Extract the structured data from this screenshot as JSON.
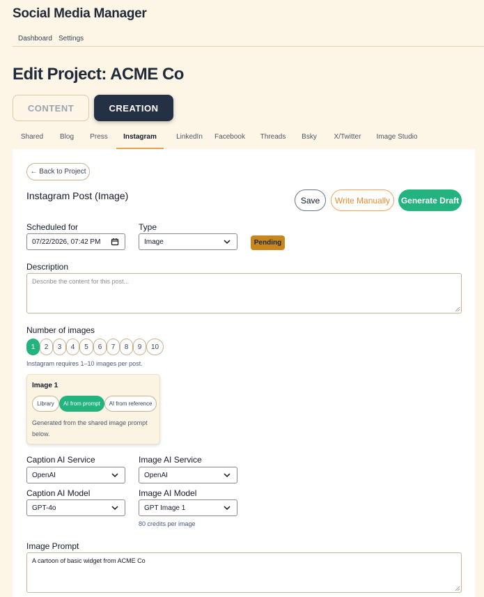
{
  "app": {
    "title": "Social Media Manager"
  },
  "topnav": {
    "items": [
      "Dashboard",
      "Settings"
    ]
  },
  "page": {
    "title": "Edit Project: ACME Co"
  },
  "modes": {
    "content": "CONTENT",
    "creation": "CREATION",
    "active": "CREATION"
  },
  "tabs": {
    "items": [
      "Shared",
      "Blog",
      "Press",
      "Instagram",
      "LinkedIn",
      "Facebook",
      "Threads",
      "Bsky",
      "X/Twitter",
      "Image Studio"
    ],
    "active": "Instagram"
  },
  "back_button": "← Back to Project",
  "post": {
    "title": "Instagram Post (Image)",
    "save_label": "Save",
    "write_manually_label": "Write Manually",
    "generate_label": "Generate Draft"
  },
  "schedule": {
    "label": "Scheduled for",
    "value": "07/22/2026, 07:42 PM"
  },
  "type": {
    "label": "Type",
    "value": "Image"
  },
  "status_badge": "Pending",
  "description": {
    "label": "Description",
    "placeholder": "Describe the content for this post..."
  },
  "images": {
    "label": "Number of images",
    "options": [
      "1",
      "2",
      "3",
      "4",
      "5",
      "6",
      "7",
      "8",
      "9",
      "10"
    ],
    "selected": "1",
    "hint": "Instagram requires 1–10 images per post."
  },
  "image_card": {
    "title": "Image 1",
    "sources": [
      "Library",
      "AI from prompt",
      "AI from reference"
    ],
    "active_source": "AI from prompt",
    "note": "Generated from the shared image prompt below."
  },
  "caption_service": {
    "label": "Caption AI Service",
    "value": "OpenAI"
  },
  "image_service": {
    "label": "Image AI Service",
    "value": "OpenAI"
  },
  "caption_model": {
    "label": "Caption AI Model",
    "value": "GPT-4o"
  },
  "image_model": {
    "label": "Image AI Model",
    "value": "GPT Image 1",
    "hint": "80 credits per image"
  },
  "image_prompt": {
    "label": "Image Prompt",
    "value": "A cartoon of basic widget from ACME Co"
  },
  "colors": {
    "accent": "#22b37e",
    "primary_dark": "#243145",
    "warning": "#c8861e",
    "orange": "#f08a2c",
    "background": "#fdf6e7"
  },
  "icons": {
    "chevron": "chevron-down-icon",
    "calendar": "calendar-icon",
    "back": "arrow-left-icon"
  }
}
